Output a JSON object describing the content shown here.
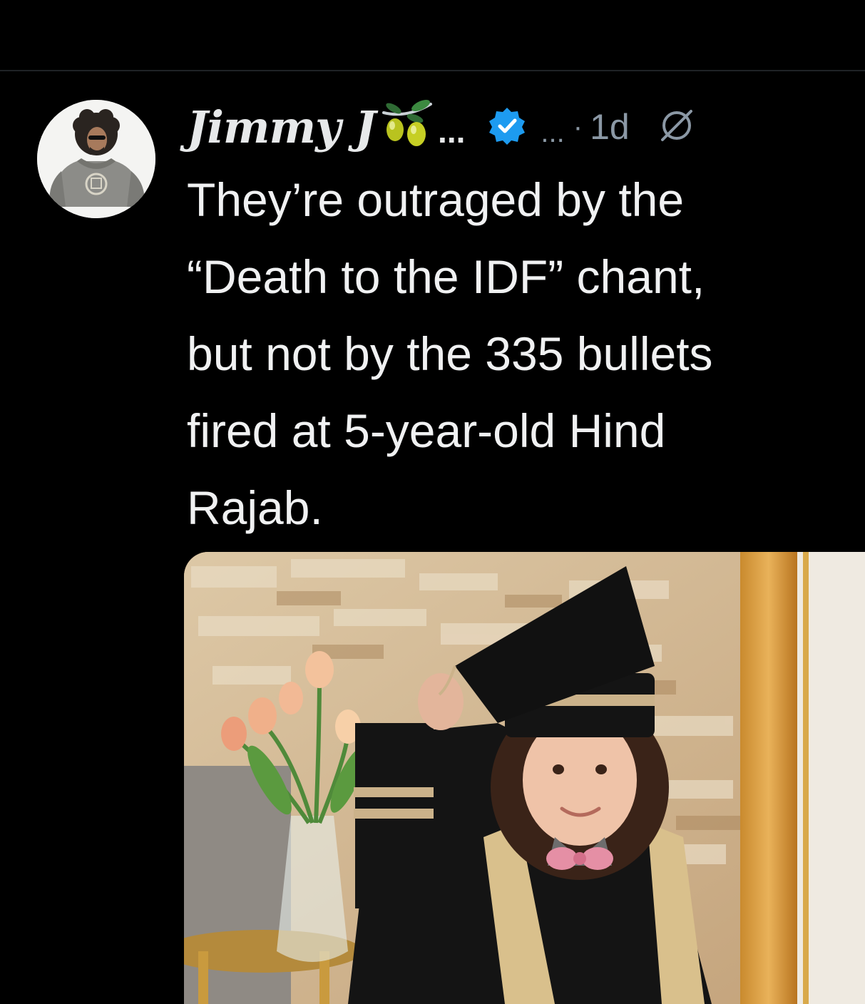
{
  "post": {
    "author": {
      "display_name": "Jimmy J",
      "emoji_icon": "olive-branch-icon",
      "name_truncation": "...",
      "verified_icon": "verified-badge-icon",
      "handle_truncation": "...",
      "separator": "·",
      "timestamp": "1d",
      "grok_icon": "grok-icon"
    },
    "text": "They’re outraged by the\n“Death to the IDF” chant,\nbut not by the 335 bullets\nfired at 5-year-old Hind\nRajab.",
    "media": {
      "type": "photo",
      "subject": "girl-in-graduation-cap-and-gown"
    }
  },
  "colors": {
    "background": "#000000",
    "text": "#e7e9ea",
    "secondary_text": "#8b98a5",
    "verified_blue": "#1d9bf0",
    "divider": "#1f2226"
  }
}
